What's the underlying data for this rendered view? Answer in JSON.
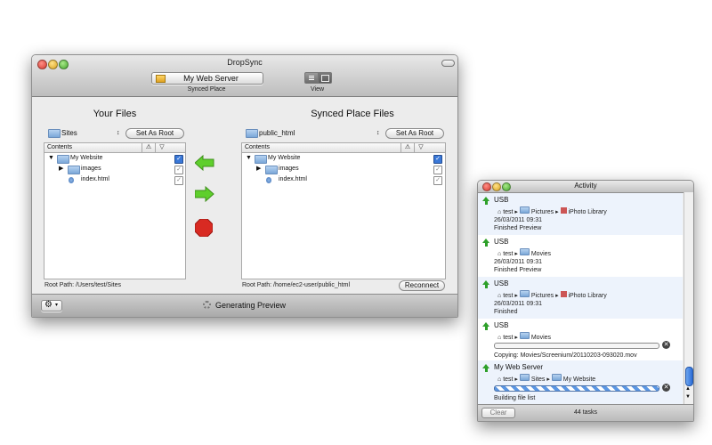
{
  "main": {
    "title": "DropSync",
    "toolbar": {
      "place_value": "My Web Server",
      "place_label": "Synced Place",
      "view_label": "View"
    },
    "left": {
      "heading": "Your Files",
      "folder_popup": "Sites",
      "set_root_label": "Set As Root",
      "column_header": "Contents",
      "rows": [
        {
          "name": "My Website",
          "checked": true
        },
        {
          "name": "images",
          "checked": false
        },
        {
          "name": "index.html",
          "checked": false
        }
      ],
      "root_path": "Root Path:  /Users/test/Sites"
    },
    "right": {
      "heading": "Synced Place Files",
      "folder_popup": "public_html",
      "set_root_label": "Set As Root",
      "column_header": "Contents",
      "rows": [
        {
          "name": "My Website",
          "checked": true
        },
        {
          "name": "images",
          "checked": false
        },
        {
          "name": "index.html",
          "checked": false
        }
      ],
      "root_path": "Root Path:  /home/ec2-user/public_html",
      "reconnect_label": "Reconnect"
    },
    "status": "Generating Preview",
    "colors": {
      "arrow_green": "#5fcf2c",
      "stop_red": "#d82a22"
    }
  },
  "activity": {
    "title": "Activity",
    "tasks": [
      {
        "place": "USB",
        "path": [
          "test",
          "Pictures",
          "iPhoto Library"
        ],
        "date": "26/03/2011 09:31",
        "status": "Finished Preview"
      },
      {
        "place": "USB",
        "path": [
          "test",
          "Movies"
        ],
        "date": "26/03/2011 09:31",
        "status": "Finished Preview"
      },
      {
        "place": "USB",
        "path": [
          "test",
          "Pictures",
          "iPhoto Library"
        ],
        "date": "26/03/2011 09:31",
        "status": "Finished"
      },
      {
        "place": "USB",
        "path": [
          "test",
          "Movies"
        ],
        "date": "",
        "status": "Copying: Movies/Screenium/20110203-093020.mov"
      },
      {
        "place": "My Web Server",
        "path": [
          "test",
          "Sites",
          "My Website"
        ],
        "date": "",
        "status": "Building file list"
      }
    ],
    "clear_label": "Clear",
    "task_count": "44 tasks"
  }
}
